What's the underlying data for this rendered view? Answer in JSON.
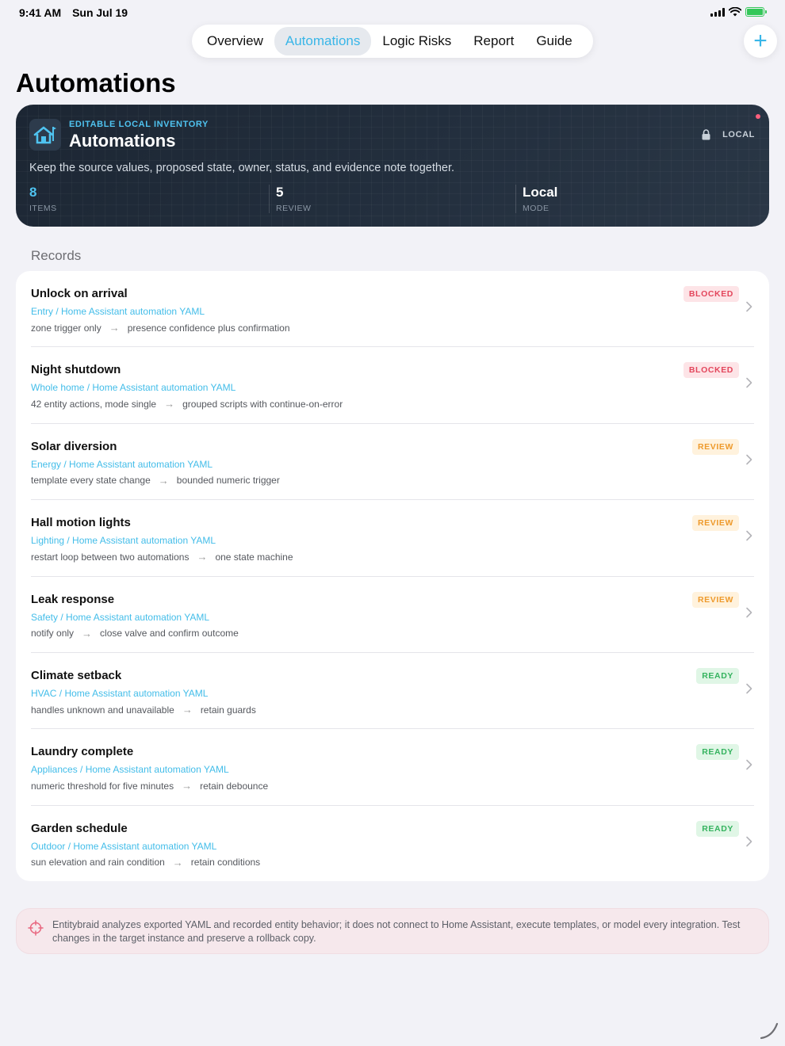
{
  "status_bar": {
    "time": "9:41 AM",
    "date": "Sun Jul 19"
  },
  "nav": {
    "tabs": [
      {
        "label": "Overview",
        "active": false
      },
      {
        "label": "Automations",
        "active": true
      },
      {
        "label": "Logic Risks",
        "active": false
      },
      {
        "label": "Report",
        "active": false
      },
      {
        "label": "Guide",
        "active": false
      }
    ],
    "add_label": "+"
  },
  "page": {
    "title": "Automations"
  },
  "hero": {
    "eyebrow": "EDITABLE LOCAL INVENTORY",
    "title": "Automations",
    "badge": "LOCAL",
    "description": "Keep the source values, proposed state, owner, status, and evidence note together.",
    "stats": [
      {
        "value": "8",
        "label": "ITEMS"
      },
      {
        "value": "5",
        "label": "REVIEW"
      },
      {
        "value": "Local",
        "label": "MODE"
      }
    ]
  },
  "records": {
    "section_label": "Records",
    "items": [
      {
        "name": "Unlock on arrival",
        "category": "Entry / Home Assistant automation YAML",
        "from": "zone trigger only",
        "to": "presence confidence plus confirmation",
        "status": "BLOCKED",
        "status_kind": "blocked"
      },
      {
        "name": "Night shutdown",
        "category": "Whole home / Home Assistant automation YAML",
        "from": "42 entity actions, mode single",
        "to": "grouped scripts with continue-on-error",
        "status": "BLOCKED",
        "status_kind": "blocked"
      },
      {
        "name": "Solar diversion",
        "category": "Energy / Home Assistant automation YAML",
        "from": "template every state change",
        "to": "bounded numeric trigger",
        "status": "REVIEW",
        "status_kind": "review"
      },
      {
        "name": "Hall motion lights",
        "category": "Lighting / Home Assistant automation YAML",
        "from": "restart loop between two automations",
        "to": "one state machine",
        "status": "REVIEW",
        "status_kind": "review"
      },
      {
        "name": "Leak response",
        "category": "Safety / Home Assistant automation YAML",
        "from": "notify only",
        "to": "close valve and confirm outcome",
        "status": "REVIEW",
        "status_kind": "review"
      },
      {
        "name": "Climate setback",
        "category": "HVAC / Home Assistant automation YAML",
        "from": "handles unknown and unavailable",
        "to": "retain guards",
        "status": "READY",
        "status_kind": "ready"
      },
      {
        "name": "Laundry complete",
        "category": "Appliances / Home Assistant automation YAML",
        "from": "numeric threshold for five minutes",
        "to": "retain debounce",
        "status": "READY",
        "status_kind": "ready"
      },
      {
        "name": "Garden schedule",
        "category": "Outdoor / Home Assistant automation YAML",
        "from": "sun elevation and rain condition",
        "to": "retain conditions",
        "status": "READY",
        "status_kind": "ready"
      }
    ]
  },
  "disclaimer": {
    "text": "Entitybraid analyzes exported YAML and recorded entity behavior; it does not connect to Home Assistant, execute templates, or model every integration. Test changes in the target instance and preserve a rollback copy."
  },
  "icons": {
    "hero": "house-icon",
    "lock": "lock-icon",
    "note": "crosshair-icon",
    "row": "chevron-right-icon"
  },
  "colors": {
    "accent": "#39b6e8",
    "blocked": "#e3465c",
    "review": "#ee9a2c",
    "ready": "#35b35f"
  }
}
